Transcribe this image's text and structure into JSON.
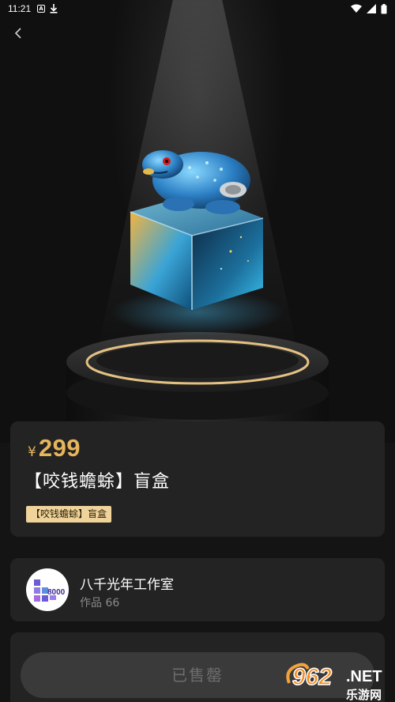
{
  "status_bar": {
    "time": "11:21"
  },
  "product": {
    "currency_symbol": "¥",
    "price": "299",
    "title": "【咬钱蟾蜍】盲盒",
    "tag": "【咬钱蟾蜍】盲盒"
  },
  "studio": {
    "name": "八千光年工作室",
    "works": "作品 66",
    "avatar_text": "8000"
  },
  "action": {
    "sold_out_label": "已售罄"
  },
  "watermark": {
    "text_main": "962",
    "text_suffix": ".NET",
    "text_sub": "乐游网"
  },
  "colors": {
    "price": "#e7b55c",
    "tag_bg": "#efd39a",
    "card_bg": "#232323",
    "page_bg": "#141414"
  }
}
